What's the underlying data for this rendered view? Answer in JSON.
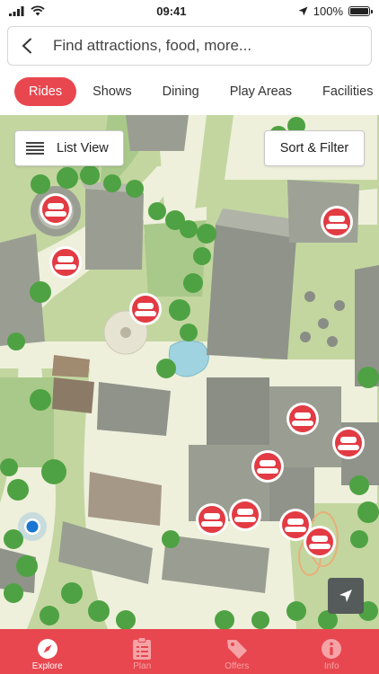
{
  "status": {
    "time": "09:41",
    "battery": "100%"
  },
  "search": {
    "placeholder": "Find attractions, food, more..."
  },
  "tabs": [
    {
      "label": "Rides",
      "active": true
    },
    {
      "label": "Shows",
      "active": false
    },
    {
      "label": "Dining",
      "active": false
    },
    {
      "label": "Play Areas",
      "active": false
    },
    {
      "label": "Facilities",
      "active": false
    }
  ],
  "map": {
    "list_view_label": "List View",
    "sort_filter_label": "Sort & Filter",
    "ride_marker_count": 12
  },
  "bottom_nav": [
    {
      "label": "Explore",
      "icon": "compass-icon",
      "active": true
    },
    {
      "label": "Plan",
      "icon": "clipboard-icon",
      "active": false
    },
    {
      "label": "Offers",
      "icon": "tag-icon",
      "active": false
    },
    {
      "label": "Info",
      "icon": "info-icon",
      "active": false
    }
  ],
  "colors": {
    "accent": "#e8474f",
    "grass": "#c8d8a8",
    "path": "#eef0dc",
    "building": "#8e9286",
    "water": "#9fd3e0"
  }
}
